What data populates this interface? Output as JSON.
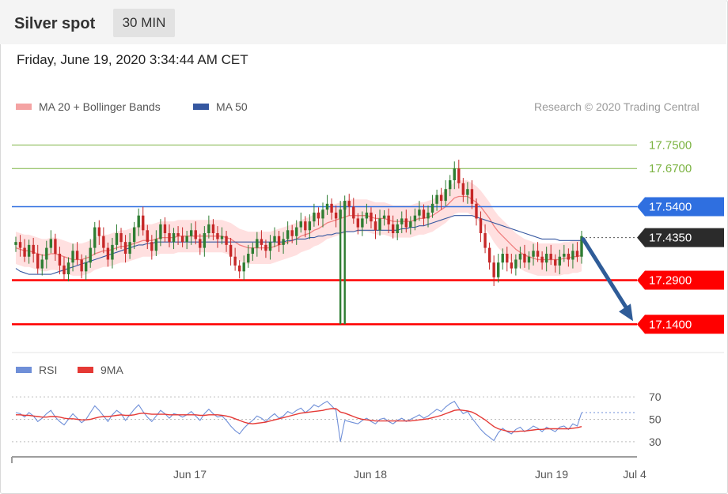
{
  "header": {
    "title": "Silver spot",
    "timeframe": "30 MIN"
  },
  "timestamp": "Friday, June 19, 2020 3:34:44 AM CET",
  "legend": {
    "ma20_label": "MA 20 + Bollinger Bands",
    "ma50_label": "MA 50",
    "credit": "Research © 2020 Trading Central",
    "rsi_label": "RSI",
    "ma9_label": "9MA"
  },
  "colors": {
    "up_candle": "#2e7d32",
    "down_candle": "#c62828",
    "bollinger_fill": "#ffd6d6",
    "ma20": "#f08080",
    "ma50": "#3557a0",
    "resistance_green": "#7cb342",
    "pivot_blue": "#2f6fe0",
    "support_red": "#ff0000",
    "rsi": "#6f8fd8",
    "rsi_ma": "#e53935",
    "arrow": "#2f5c98"
  },
  "chart_data": [
    {
      "type": "candlestick",
      "title": "Silver spot",
      "ylim": [
        17.06,
        17.84
      ],
      "x_labels": [
        "Jun 17",
        "Jun 18",
        "Jun 19",
        "Jul 4"
      ],
      "levels": [
        {
          "value": 17.75,
          "label": "17.7500",
          "kind": "resistance"
        },
        {
          "value": 17.67,
          "label": "17.6700",
          "kind": "resistance"
        },
        {
          "value": 17.54,
          "label": "17.5400",
          "kind": "pivot"
        },
        {
          "value": 17.435,
          "label": "17.4350",
          "kind": "last"
        },
        {
          "value": 17.29,
          "label": "17.2900",
          "kind": "support"
        },
        {
          "value": 17.14,
          "label": "17.1400",
          "kind": "support"
        }
      ],
      "close": [
        17.42,
        17.4,
        17.37,
        17.41,
        17.38,
        17.33,
        17.36,
        17.4,
        17.43,
        17.38,
        17.34,
        17.31,
        17.35,
        17.39,
        17.36,
        17.32,
        17.35,
        17.4,
        17.47,
        17.44,
        17.4,
        17.36,
        17.41,
        17.45,
        17.42,
        17.38,
        17.42,
        17.47,
        17.51,
        17.46,
        17.42,
        17.39,
        17.43,
        17.48,
        17.45,
        17.42,
        17.45,
        17.44,
        17.42,
        17.44,
        17.46,
        17.43,
        17.4,
        17.45,
        17.48,
        17.45,
        17.43,
        17.44,
        17.41,
        17.37,
        17.34,
        17.32,
        17.35,
        17.38,
        17.4,
        17.43,
        17.41,
        17.39,
        17.42,
        17.44,
        17.41,
        17.43,
        17.46,
        17.44,
        17.47,
        17.49,
        17.46,
        17.49,
        17.52,
        17.5,
        17.53,
        17.55,
        17.52,
        17.5,
        17.53,
        17.56,
        17.54,
        17.5,
        17.47,
        17.5,
        17.52,
        17.49,
        17.46,
        17.5,
        17.51,
        17.48,
        17.45,
        17.48,
        17.5,
        17.47,
        17.49,
        17.51,
        17.53,
        17.5,
        17.52,
        17.55,
        17.58,
        17.56,
        17.6,
        17.63,
        17.67,
        17.62,
        17.58,
        17.6,
        17.55,
        17.5,
        17.45,
        17.4,
        17.35,
        17.3,
        17.35,
        17.38,
        17.35,
        17.33,
        17.36,
        17.38,
        17.35,
        17.37,
        17.39,
        17.37,
        17.35,
        17.38,
        17.36,
        17.34,
        17.37,
        17.38,
        17.36,
        17.39,
        17.37,
        17.44
      ],
      "ma20": [
        17.4,
        17.395,
        17.39,
        17.39,
        17.385,
        17.38,
        17.375,
        17.375,
        17.38,
        17.38,
        17.375,
        17.37,
        17.365,
        17.36,
        17.36,
        17.36,
        17.365,
        17.37,
        17.38,
        17.385,
        17.39,
        17.39,
        17.395,
        17.4,
        17.405,
        17.405,
        17.41,
        17.415,
        17.42,
        17.425,
        17.425,
        17.425,
        17.43,
        17.435,
        17.435,
        17.435,
        17.435,
        17.44,
        17.44,
        17.44,
        17.44,
        17.44,
        17.44,
        17.44,
        17.44,
        17.44,
        17.44,
        17.44,
        17.435,
        17.43,
        17.42,
        17.41,
        17.405,
        17.4,
        17.4,
        17.4,
        17.4,
        17.4,
        17.4,
        17.405,
        17.41,
        17.415,
        17.42,
        17.425,
        17.43,
        17.44,
        17.445,
        17.45,
        17.46,
        17.465,
        17.475,
        17.485,
        17.49,
        17.495,
        17.5,
        17.505,
        17.51,
        17.51,
        17.51,
        17.51,
        17.51,
        17.505,
        17.5,
        17.5,
        17.5,
        17.495,
        17.49,
        17.49,
        17.49,
        17.49,
        17.49,
        17.495,
        17.5,
        17.5,
        17.505,
        17.51,
        17.52,
        17.53,
        17.54,
        17.555,
        17.57,
        17.575,
        17.575,
        17.575,
        17.565,
        17.555,
        17.54,
        17.52,
        17.5,
        17.475,
        17.455,
        17.44,
        17.425,
        17.41,
        17.395,
        17.385,
        17.375,
        17.37,
        17.365,
        17.36,
        17.36,
        17.36,
        17.36,
        17.36,
        17.36,
        17.365,
        17.365,
        17.37,
        17.37,
        17.375
      ],
      "ma50": [
        17.33,
        17.32,
        17.315,
        17.31,
        17.31,
        17.31,
        17.31,
        17.31,
        17.31,
        17.315,
        17.32,
        17.325,
        17.33,
        17.335,
        17.34,
        17.345,
        17.35,
        17.355,
        17.36,
        17.365,
        17.37,
        17.375,
        17.38,
        17.385,
        17.39,
        17.395,
        17.4,
        17.405,
        17.41,
        17.41,
        17.415,
        17.415,
        17.42,
        17.42,
        17.42,
        17.42,
        17.42,
        17.42,
        17.42,
        17.42,
        17.42,
        17.42,
        17.42,
        17.42,
        17.42,
        17.42,
        17.42,
        17.42,
        17.42,
        17.42,
        17.42,
        17.42,
        17.42,
        17.42,
        17.42,
        17.42,
        17.42,
        17.42,
        17.42,
        17.42,
        17.42,
        17.42,
        17.425,
        17.425,
        17.43,
        17.43,
        17.43,
        17.435,
        17.435,
        17.44,
        17.44,
        17.445,
        17.445,
        17.45,
        17.45,
        17.455,
        17.455,
        17.455,
        17.46,
        17.46,
        17.46,
        17.46,
        17.46,
        17.46,
        17.46,
        17.46,
        17.46,
        17.46,
        17.465,
        17.465,
        17.47,
        17.47,
        17.475,
        17.475,
        17.48,
        17.485,
        17.49,
        17.495,
        17.5,
        17.505,
        17.51,
        17.51,
        17.51,
        17.51,
        17.51,
        17.505,
        17.5,
        17.495,
        17.49,
        17.485,
        17.48,
        17.475,
        17.47,
        17.465,
        17.46,
        17.455,
        17.45,
        17.445,
        17.44,
        17.435,
        17.43,
        17.43,
        17.43,
        17.43,
        17.425,
        17.425,
        17.425,
        17.425,
        17.425,
        17.425
      ],
      "spikes": [
        {
          "index": 74,
          "low": 17.14
        },
        {
          "index": 75,
          "low": 17.14
        }
      ],
      "forecast": {
        "from": 17.435,
        "to": 17.14
      }
    },
    {
      "type": "line",
      "title": "RSI",
      "ylim": [
        20,
        80
      ],
      "y_ticks": [
        {
          "value": 70,
          "label": "70"
        },
        {
          "value": 50,
          "label": "50"
        },
        {
          "value": 30,
          "label": "30"
        }
      ],
      "series": [
        {
          "name": "RSI",
          "values": [
            56,
            55,
            52,
            56,
            53,
            48,
            51,
            55,
            58,
            52,
            48,
            45,
            50,
            55,
            51,
            47,
            50,
            56,
            62,
            58,
            53,
            48,
            54,
            58,
            55,
            49,
            54,
            59,
            63,
            57,
            52,
            48,
            53,
            58,
            55,
            51,
            55,
            54,
            52,
            54,
            57,
            53,
            49,
            55,
            59,
            55,
            52,
            53,
            49,
            44,
            40,
            37,
            42,
            46,
            49,
            53,
            51,
            48,
            52,
            55,
            51,
            53,
            57,
            55,
            58,
            60,
            56,
            59,
            63,
            61,
            64,
            66,
            62,
            58,
            30,
            49,
            48,
            47,
            46,
            49,
            51,
            48,
            46,
            50,
            51,
            48,
            46,
            49,
            51,
            48,
            50,
            52,
            54,
            51,
            53,
            56,
            59,
            57,
            61,
            64,
            66,
            60,
            55,
            57,
            51,
            46,
            41,
            37,
            34,
            31,
            38,
            42,
            39,
            37,
            41,
            43,
            39,
            41,
            44,
            42,
            39,
            43,
            41,
            39,
            43,
            44,
            41,
            46,
            44,
            56
          ]
        },
        {
          "name": "9MA",
          "values": [
            54,
            54,
            53.5,
            53.5,
            53,
            52.5,
            52,
            52,
            52.5,
            52.5,
            52,
            51,
            50.5,
            50.5,
            50,
            49.5,
            49.5,
            50,
            51,
            52,
            52.5,
            52.5,
            53,
            53.5,
            54,
            53.5,
            53.5,
            54,
            55,
            55.5,
            55,
            54.5,
            54.5,
            54.5,
            54.5,
            54,
            54,
            54,
            54,
            54,
            54,
            54,
            53.5,
            53.5,
            54,
            54,
            54,
            53.5,
            53,
            52,
            50.5,
            49,
            47.5,
            46.5,
            46,
            46.5,
            47,
            47.5,
            48.5,
            49.5,
            50.5,
            51.5,
            52.5,
            53.5,
            54.5,
            55.5,
            56,
            56.5,
            57,
            57.5,
            58,
            59,
            59.5,
            59.5,
            56.5,
            55.5,
            54,
            52.5,
            51,
            50,
            49.5,
            49,
            48.5,
            48.5,
            48.5,
            48.5,
            48.5,
            48.5,
            48.5,
            48.5,
            48.5,
            49,
            49.5,
            50,
            50.5,
            51.5,
            52.5,
            53.5,
            55,
            56.5,
            58,
            58.5,
            58,
            57.5,
            56.5,
            54.5,
            52,
            49.5,
            46.5,
            43.5,
            41.5,
            40.5,
            39.5,
            39,
            39,
            39.5,
            39.5,
            40,
            40.5,
            41,
            41,
            41.5,
            41.5,
            41.5,
            41.5,
            41.5,
            41.5,
            42,
            42.5,
            43.5
          ]
        }
      ]
    }
  ]
}
